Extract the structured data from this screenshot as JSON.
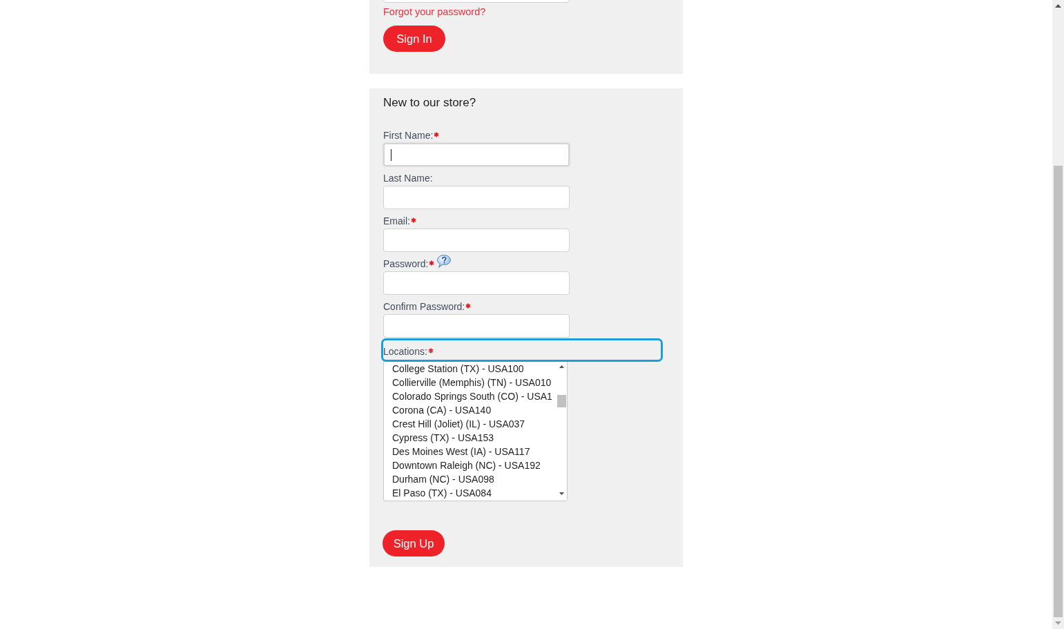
{
  "sign_in": {
    "fields": [
      {
        "focused": false
      }
    ],
    "forgot_link": "Forgot your password?",
    "button": "Sign In"
  },
  "sign_up": {
    "title": "New to our store?",
    "fields": [
      {
        "label": "First Name:",
        "required": true,
        "help": false,
        "focused": true
      },
      {
        "label": "Last Name:",
        "required": false,
        "help": false,
        "focused": false
      },
      {
        "label": "Email:",
        "required": true,
        "help": false,
        "focused": false
      },
      {
        "label": "Password:",
        "required": true,
        "help": true,
        "focused": false
      },
      {
        "label": "Confirm Password:",
        "required": true,
        "help": false,
        "focused": false
      }
    ],
    "locations": {
      "label": "Locations:",
      "required": true,
      "highlighted": true,
      "options": [
        {
          "text": "College Station (TX) - USA100",
          "selected": false
        },
        {
          "text": "Collierville (Memphis) (TN) - USA010",
          "selected": false
        },
        {
          "text": "Colorado Springs South (CO) - USA1",
          "selected": false
        },
        {
          "text": "Corona (CA) - USA140",
          "selected": false
        },
        {
          "text": "Crest Hill (Joliet) (IL) - USA037",
          "selected": false
        },
        {
          "text": "Cypress (TX) - USA153",
          "selected": false
        },
        {
          "text": "Des Moines West (IA) - USA117",
          "selected": false
        },
        {
          "text": "Downtown Raleigh (NC) - USA192",
          "selected": false
        },
        {
          "text": "Durham (NC) - USA098",
          "selected": false
        },
        {
          "text": "El Paso (TX) - USA084",
          "selected": false
        }
      ]
    },
    "button": "Sign Up"
  }
}
